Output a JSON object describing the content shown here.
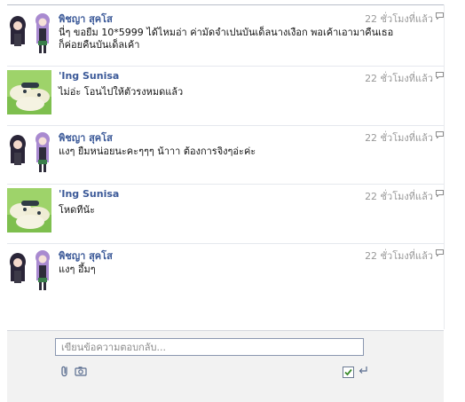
{
  "messages": [
    {
      "sender": "พิชญา สุคโส",
      "time": "22 ชั่วโมงที่แล้ว",
      "text": "นี่ๆ ขอยืม 10*5999 ได้ไหมอ่า ค่ามัดจำเปนบันเด็ลนางเงือก พอเค้าเอามาคืนเธอก็ค่อยคืนบันเด็ลเค้า",
      "avatar": "anime-girl-avatar"
    },
    {
      "sender": "'Ing Sunisa",
      "time": "22 ชั่วโมงที่แล้ว",
      "text": "ไม่อ่ะ โอนไปให้ตัวรงหมดแล้ว",
      "avatar": "sheep-avatar"
    },
    {
      "sender": "พิชญา สุคโส",
      "time": "22 ชั่วโมงที่แล้ว",
      "text": "แงๆ ยืมหน่อยนะคะๆๆๆ น้าาา ต้องการจิงๆอ่ะค่ะ",
      "avatar": "anime-girl-avatar"
    },
    {
      "sender": "'Ing Sunisa",
      "time": "22 ชั่วโมงที่แล้ว",
      "text": "โหดทีนัะ",
      "avatar": "sheep-avatar"
    },
    {
      "sender": "พิชญา สุคโส",
      "time": "22 ชั่วโมงที่แล้ว",
      "text": "แงๆ อึ้มๆ",
      "avatar": "anime-girl-avatar"
    }
  ],
  "composer": {
    "placeholder": "เขียนข้อความตอบกลับ...",
    "attach_icon": "paperclip-icon",
    "photo_icon": "camera-icon",
    "enter_to_send_checked": true,
    "enter_icon": "enter-arrow-icon"
  },
  "colors": {
    "name_link": "#3b5998",
    "timestamp": "#999999",
    "composer_bg": "#f2f2f2"
  }
}
